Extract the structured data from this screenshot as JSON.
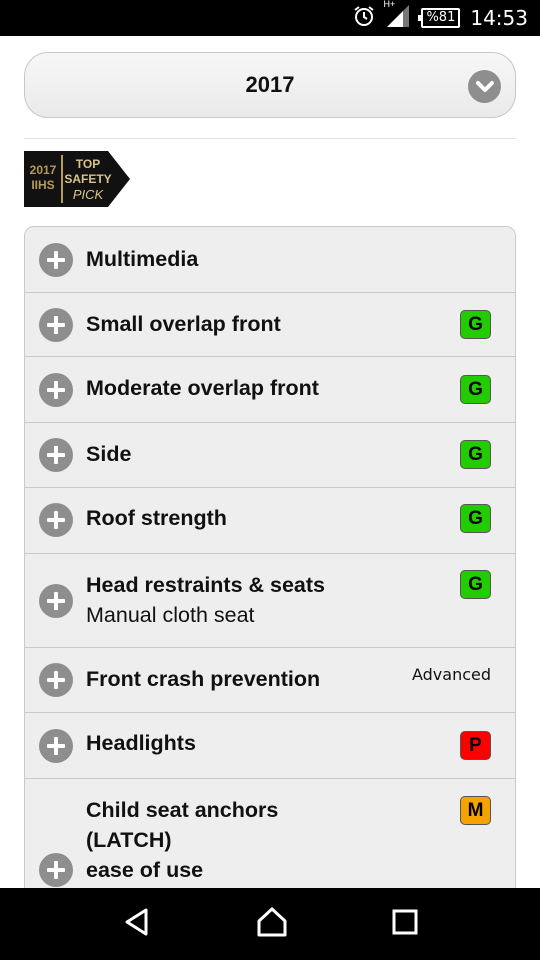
{
  "status_bar": {
    "time": "14:53",
    "battery": "%81",
    "network": "H+"
  },
  "year_selector": {
    "value": "2017"
  },
  "award": {
    "year": "2017",
    "org": "IIHS",
    "line1": "TOP",
    "line2": "SAFETY",
    "line3": "PICK"
  },
  "ratings": [
    {
      "label": "Multimedia",
      "sub": "",
      "rating": ""
    },
    {
      "label": "Small overlap front",
      "sub": "",
      "rating": "G"
    },
    {
      "label": "Moderate overlap front",
      "sub": "",
      "rating": "G"
    },
    {
      "label": "Side",
      "sub": "",
      "rating": "G"
    },
    {
      "label": "Roof strength",
      "sub": "",
      "rating": "G"
    },
    {
      "label": "Head restraints & seats",
      "sub": "Manual cloth seat",
      "rating": "G"
    },
    {
      "label": "Front crash prevention",
      "sub": "",
      "rating_text": "Advanced"
    },
    {
      "label": "Headlights",
      "sub": "",
      "rating": "P"
    },
    {
      "label_lines": [
        "Child seat anchors",
        "(LATCH)",
        "ease of use"
      ],
      "rating": "M"
    }
  ],
  "colors": {
    "good": "#22cc00",
    "poor": "#ff0000",
    "marginal": "#f5a300",
    "icon_gray": "#8e8e8e"
  }
}
